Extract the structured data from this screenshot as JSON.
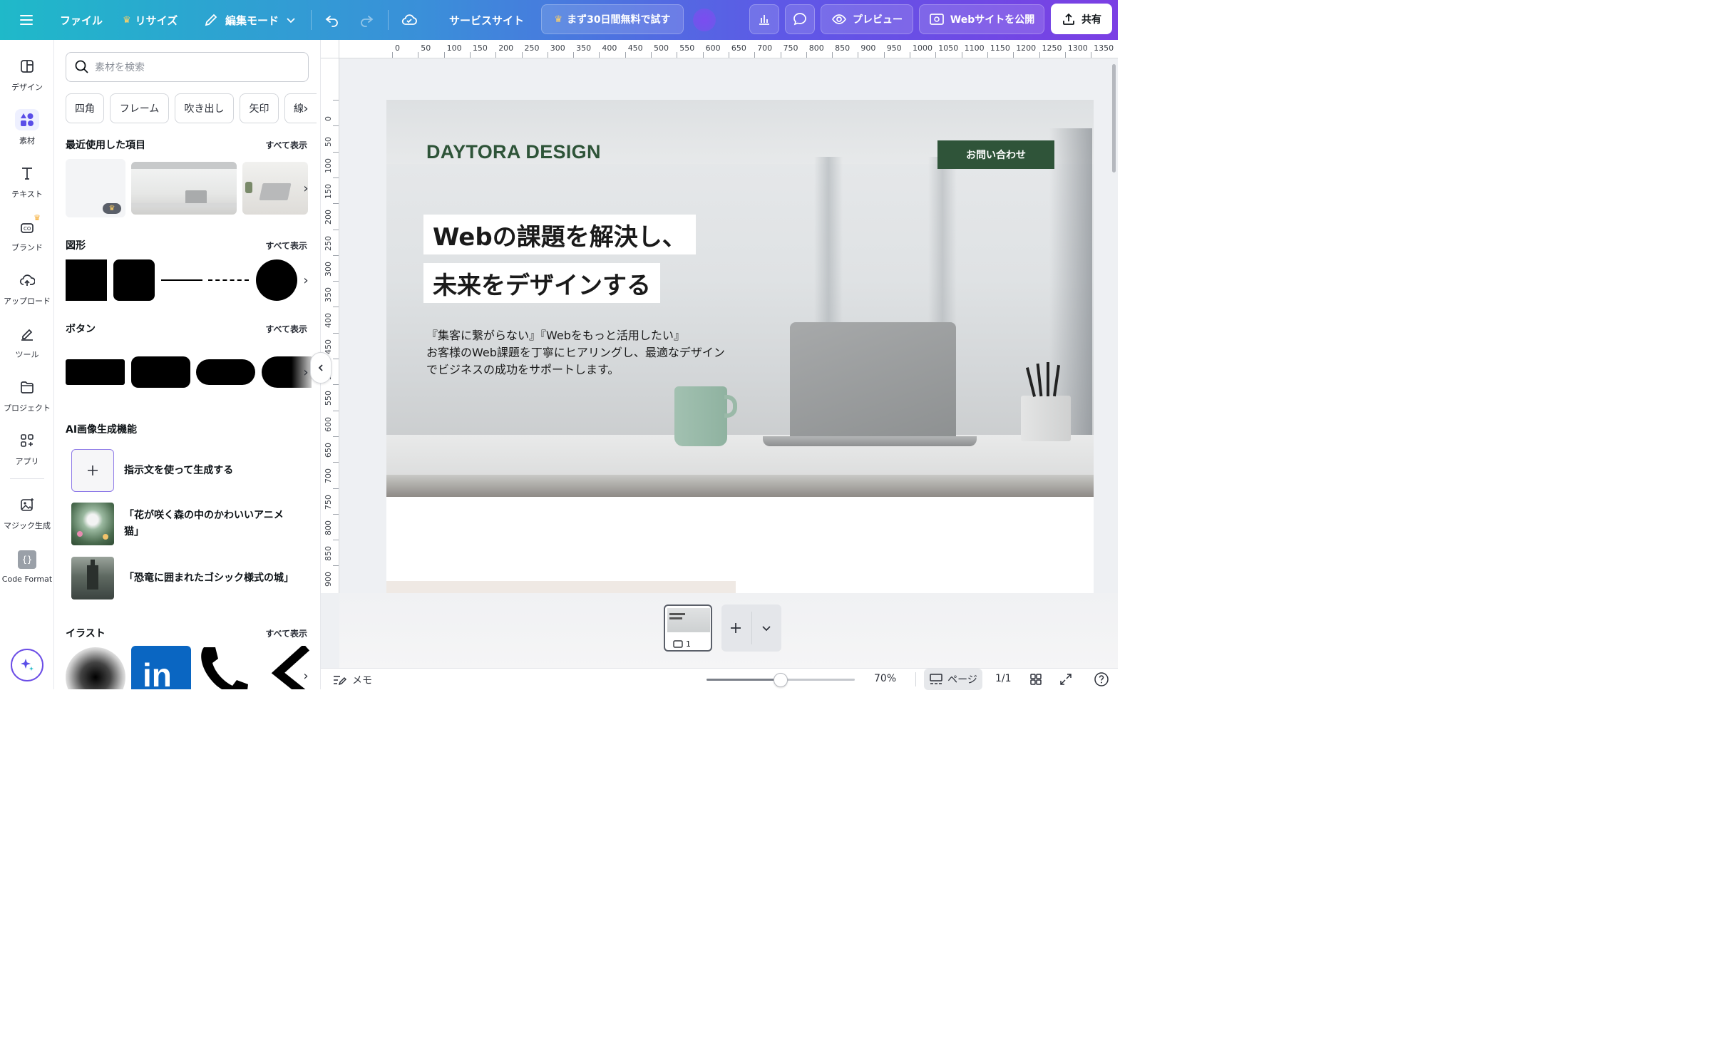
{
  "topbar": {
    "file": "ファイル",
    "resize": "リサイズ",
    "edit_mode": "編集モード",
    "site_name": "サービスサイト",
    "trial": "まず30日間無料で試す",
    "preview": "プレビュー",
    "publish": "Webサイトを公開",
    "share": "共有"
  },
  "rail": {
    "items": [
      "デザイン",
      "素材",
      "テキスト",
      "ブランド",
      "アップロード",
      "ツール",
      "プロジェクト",
      "アプリ",
      "マジック生成",
      "Code Format"
    ]
  },
  "panel": {
    "search_placeholder": "素材を検索",
    "chips": [
      "四角",
      "フレーム",
      "吹き出し",
      "矢印",
      "線"
    ],
    "see_all": "すべて表示",
    "recent_title": "最近使用した項目",
    "shapes_title": "図形",
    "buttons_title": "ボタン",
    "ai_title": "AI画像生成機能",
    "ai_generate": "指示文を使って生成する",
    "ai_prompt1": "「花が咲く森の中のかわいいアニメ猫」",
    "ai_prompt1_line1": "「花が咲く森の中のかわいいアニメ",
    "ai_prompt1_line2": "猫」",
    "ai_prompt2": "「恐竜に囲まれたゴシック様式の城」",
    "illust_title": "イラスト"
  },
  "ruler": {
    "top": [
      "0",
      "50",
      "100",
      "150",
      "200",
      "250",
      "300",
      "350",
      "400",
      "450",
      "500",
      "550",
      "600",
      "650",
      "700",
      "750",
      "800",
      "850",
      "900",
      "950",
      "1000",
      "1050",
      "1100",
      "1150",
      "1200",
      "1250",
      "1300",
      "1350"
    ],
    "left": [
      "0",
      "50",
      "100",
      "150",
      "200",
      "250",
      "300",
      "350",
      "400",
      "450",
      "500",
      "550",
      "600",
      "650",
      "700",
      "750",
      "800",
      "850",
      "900"
    ]
  },
  "design": {
    "logo": "DAYTORA DESIGN",
    "contact": "お問い合わせ",
    "headline1": "Webの課題を解決し、",
    "headline2": "未来をデザインする",
    "lead1": "『集客に繋がらない』『Webをもっと活用したい』",
    "lead2": "お客様のWeb課題を丁寧にヒアリングし、最適なデザイン",
    "lead3": "でビジネスの成功をサポートします。"
  },
  "pages": {
    "current": "1"
  },
  "status": {
    "notes": "メモ",
    "zoom": "70%",
    "page_label": "ページ",
    "page_count": "1/1",
    "zoom_value": 0.5
  },
  "colors": {
    "brand_green": "#2f5439",
    "topbar_start": "#1fb9c9",
    "topbar_end": "#7b3fe4",
    "accent": "#6b4de6"
  }
}
